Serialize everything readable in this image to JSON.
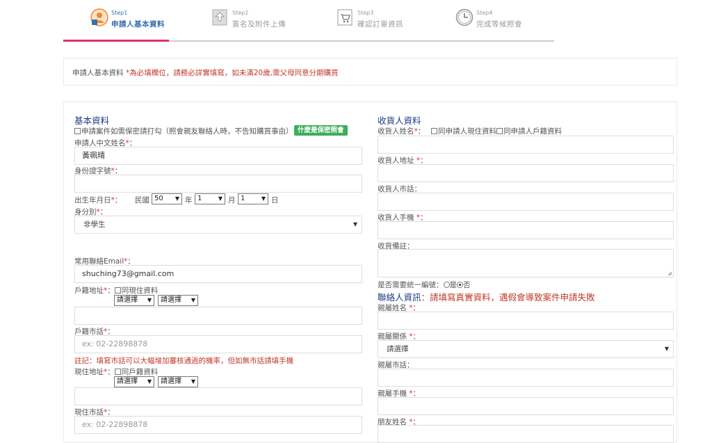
{
  "steps": [
    {
      "num": "Step1",
      "label": "申請人基本資料",
      "icon": "user-form-icon"
    },
    {
      "num": "Step2",
      "label": "簽名及附件上傳",
      "icon": "upload-icon"
    },
    {
      "num": "Step3",
      "label": "確認訂單資訊",
      "icon": "cart-check-icon"
    },
    {
      "num": "Step4",
      "label": "完成等候照會",
      "icon": "clock-icon"
    }
  ],
  "progress": {
    "completed_steps": 1,
    "total_steps": 3
  },
  "notice": {
    "prefix": "申請人基本資料",
    "highlight": "*為必填欄位，請務必詳實填寫，如未滿20歲,需父母同意分期購買"
  },
  "basic": {
    "title": "基本資料",
    "confidential_label": "申請案件如需保密請打勾（照會親友聯絡人時，不告知購買事由）",
    "confidential_btn": "什麼是保密照會",
    "name_label": "申請人中文姓名",
    "name_value": "黃珮晴",
    "id_label": "身份證字號",
    "id_value": "",
    "dob_label": "出生年月日",
    "dob_era": "民國",
    "dob_year": "50",
    "dob_year_unit": "年",
    "dob_month": "1",
    "dob_month_unit": "月",
    "dob_day": "1",
    "dob_day_unit": "日",
    "identity_label": "身分別",
    "identity_value": "非學生",
    "email_label": "常用聯絡Email",
    "email_value": "shuching73@gmail.com",
    "reg_addr_label": "戶籍地址",
    "reg_addr_same": "同現住資料",
    "select_placeholder": "請選擇",
    "reg_tel_label": "戶籍市話",
    "tel_placeholder": "ex: 02-22898878",
    "tel_note": "註記：填寫市話可以大幅增加審核通過的機率，但如無市話請填手機",
    "cur_addr_label": "現住地址",
    "cur_addr_same": "同戶籍資料",
    "cur_tel_label": "現住市話"
  },
  "receiver": {
    "title": "收貨人資料",
    "name_label": "收貨人姓名",
    "same_current": "同申請人現住資料",
    "same_registered": "同申請人戶籍資料",
    "addr_label": "收貨人地址",
    "tel_label": "收貨人市話",
    "mobile_label": "收貨人手機",
    "note_label": "收貨備註",
    "invoice_label": "是否需要統一編號",
    "invoice_yes": "是",
    "invoice_no": "否",
    "invoice_selected": "否"
  },
  "contact": {
    "title": "聯絡人資訊",
    "title_warning": "：請填寫真實資料，遇假會導致案件申請失敗",
    "relative_name_label": "親屬姓名",
    "relation_label": "親屬關係",
    "relation_value": "請選擇",
    "relative_tel_label": "親屬市話",
    "relative_mobile_label": "親屬手機",
    "friend_name_label": "朋友姓名"
  }
}
